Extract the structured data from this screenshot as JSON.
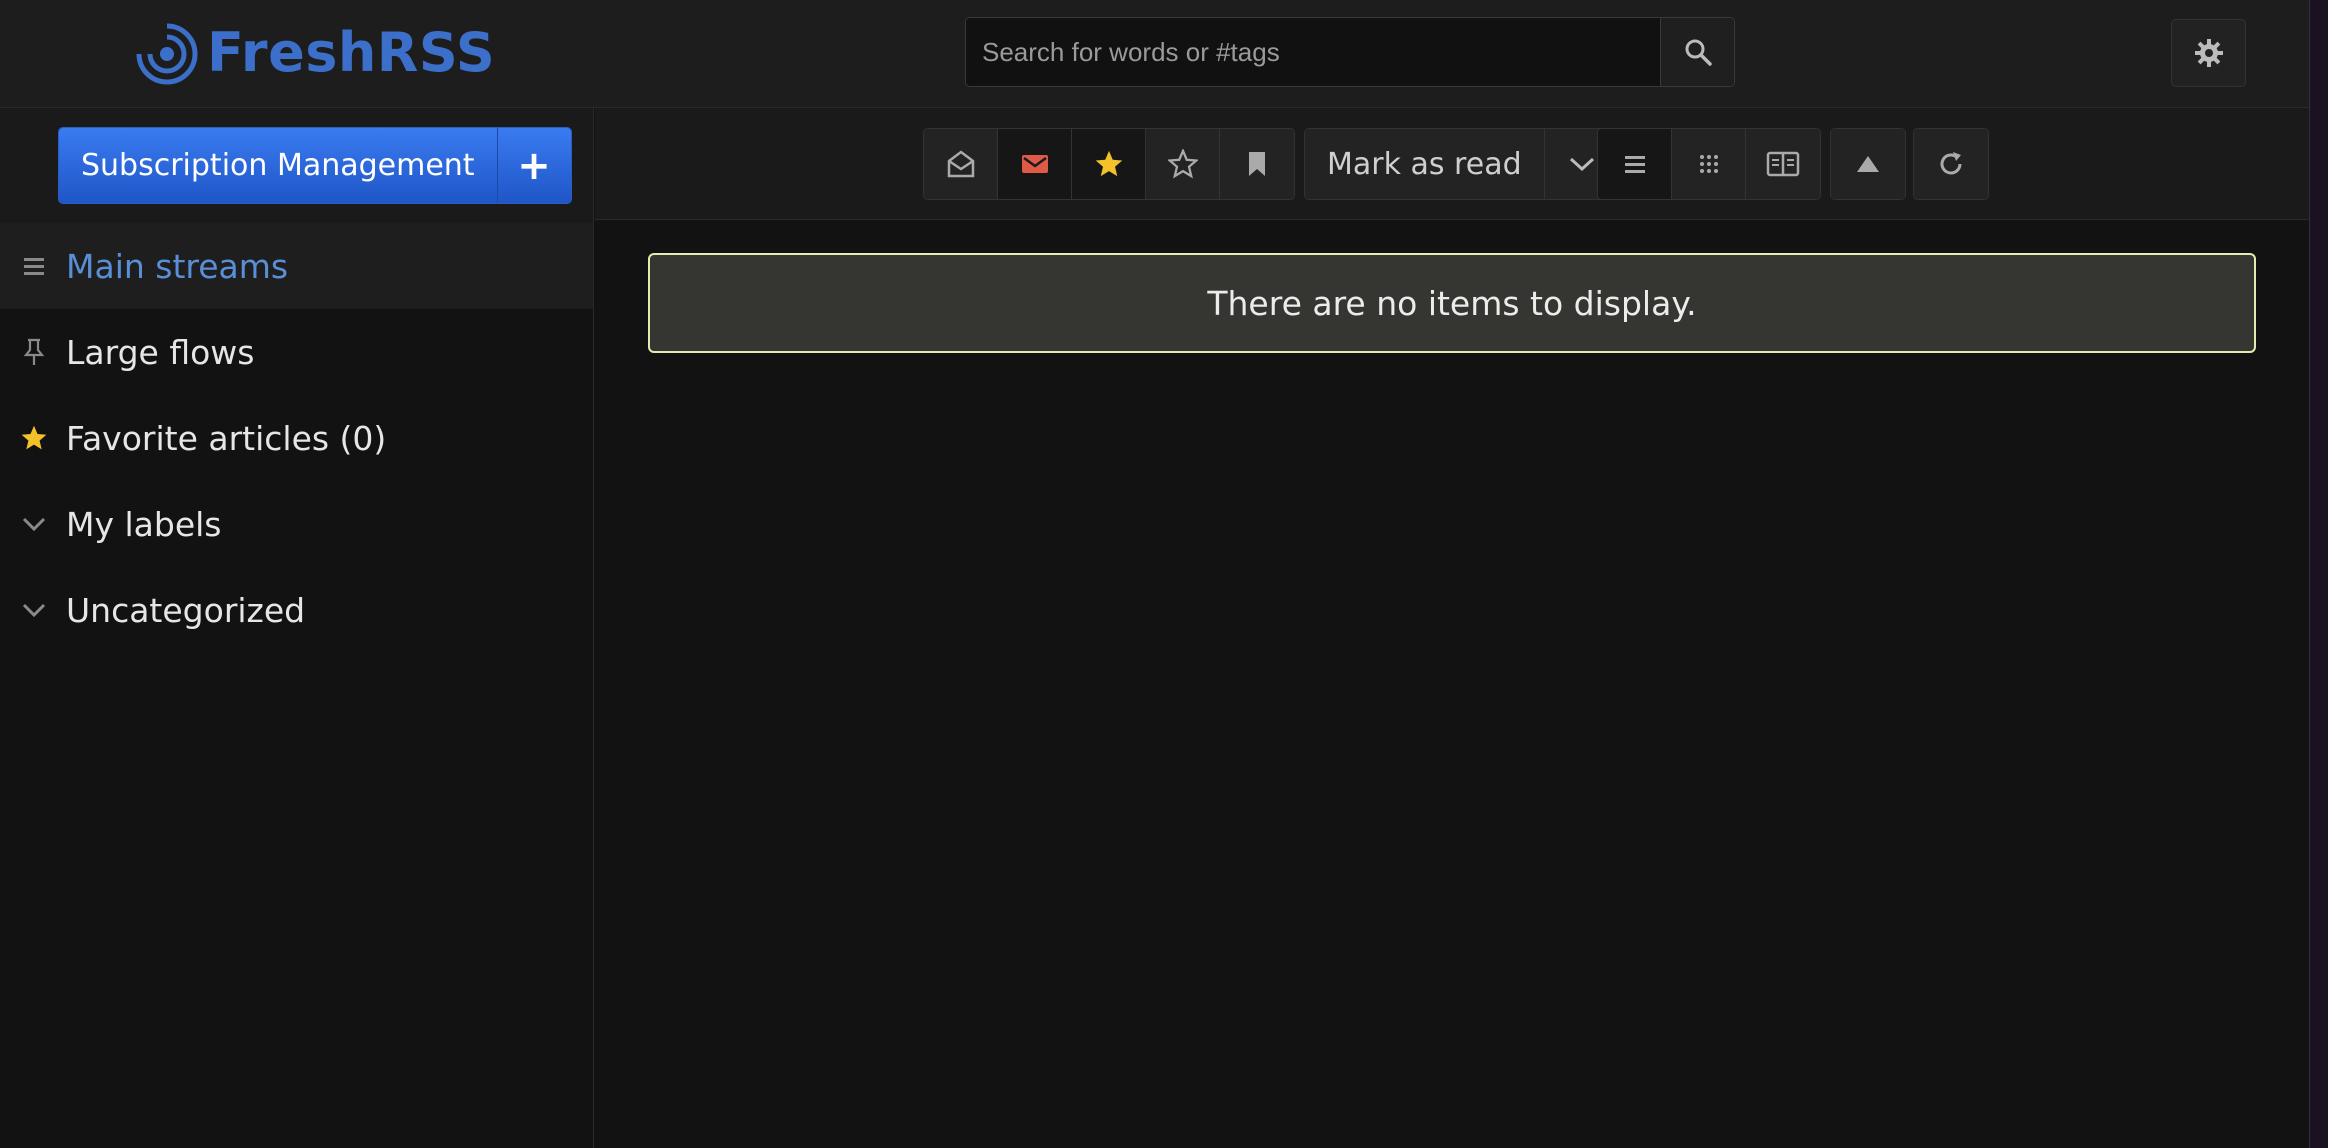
{
  "header": {
    "app_name": "FreshRSS",
    "search_placeholder": "Search for words or #tags",
    "search_value": ""
  },
  "sidebar": {
    "subscription_label": "Subscription Management",
    "add_label": "+",
    "items": [
      {
        "label": "Main streams",
        "icon": "list-icon",
        "active": true
      },
      {
        "label": "Large flows",
        "icon": "pin-icon",
        "active": false
      },
      {
        "label": "Favorite articles (0)",
        "icon": "star-icon",
        "active": false
      },
      {
        "label": "My labels",
        "icon": "chevron-down-icon",
        "active": false
      },
      {
        "label": "Uncategorized",
        "icon": "chevron-down-icon",
        "active": false
      }
    ]
  },
  "toolbar": {
    "mark_as_read_label": "Mark as read"
  },
  "main": {
    "empty_message": "There are no items to display."
  },
  "colors": {
    "accent_blue": "#3b6fc9",
    "active_link": "#5a8fd8",
    "unread_red": "#e05a48",
    "star_yellow": "#f3c22b",
    "notice_border": "#e6ecb0"
  }
}
